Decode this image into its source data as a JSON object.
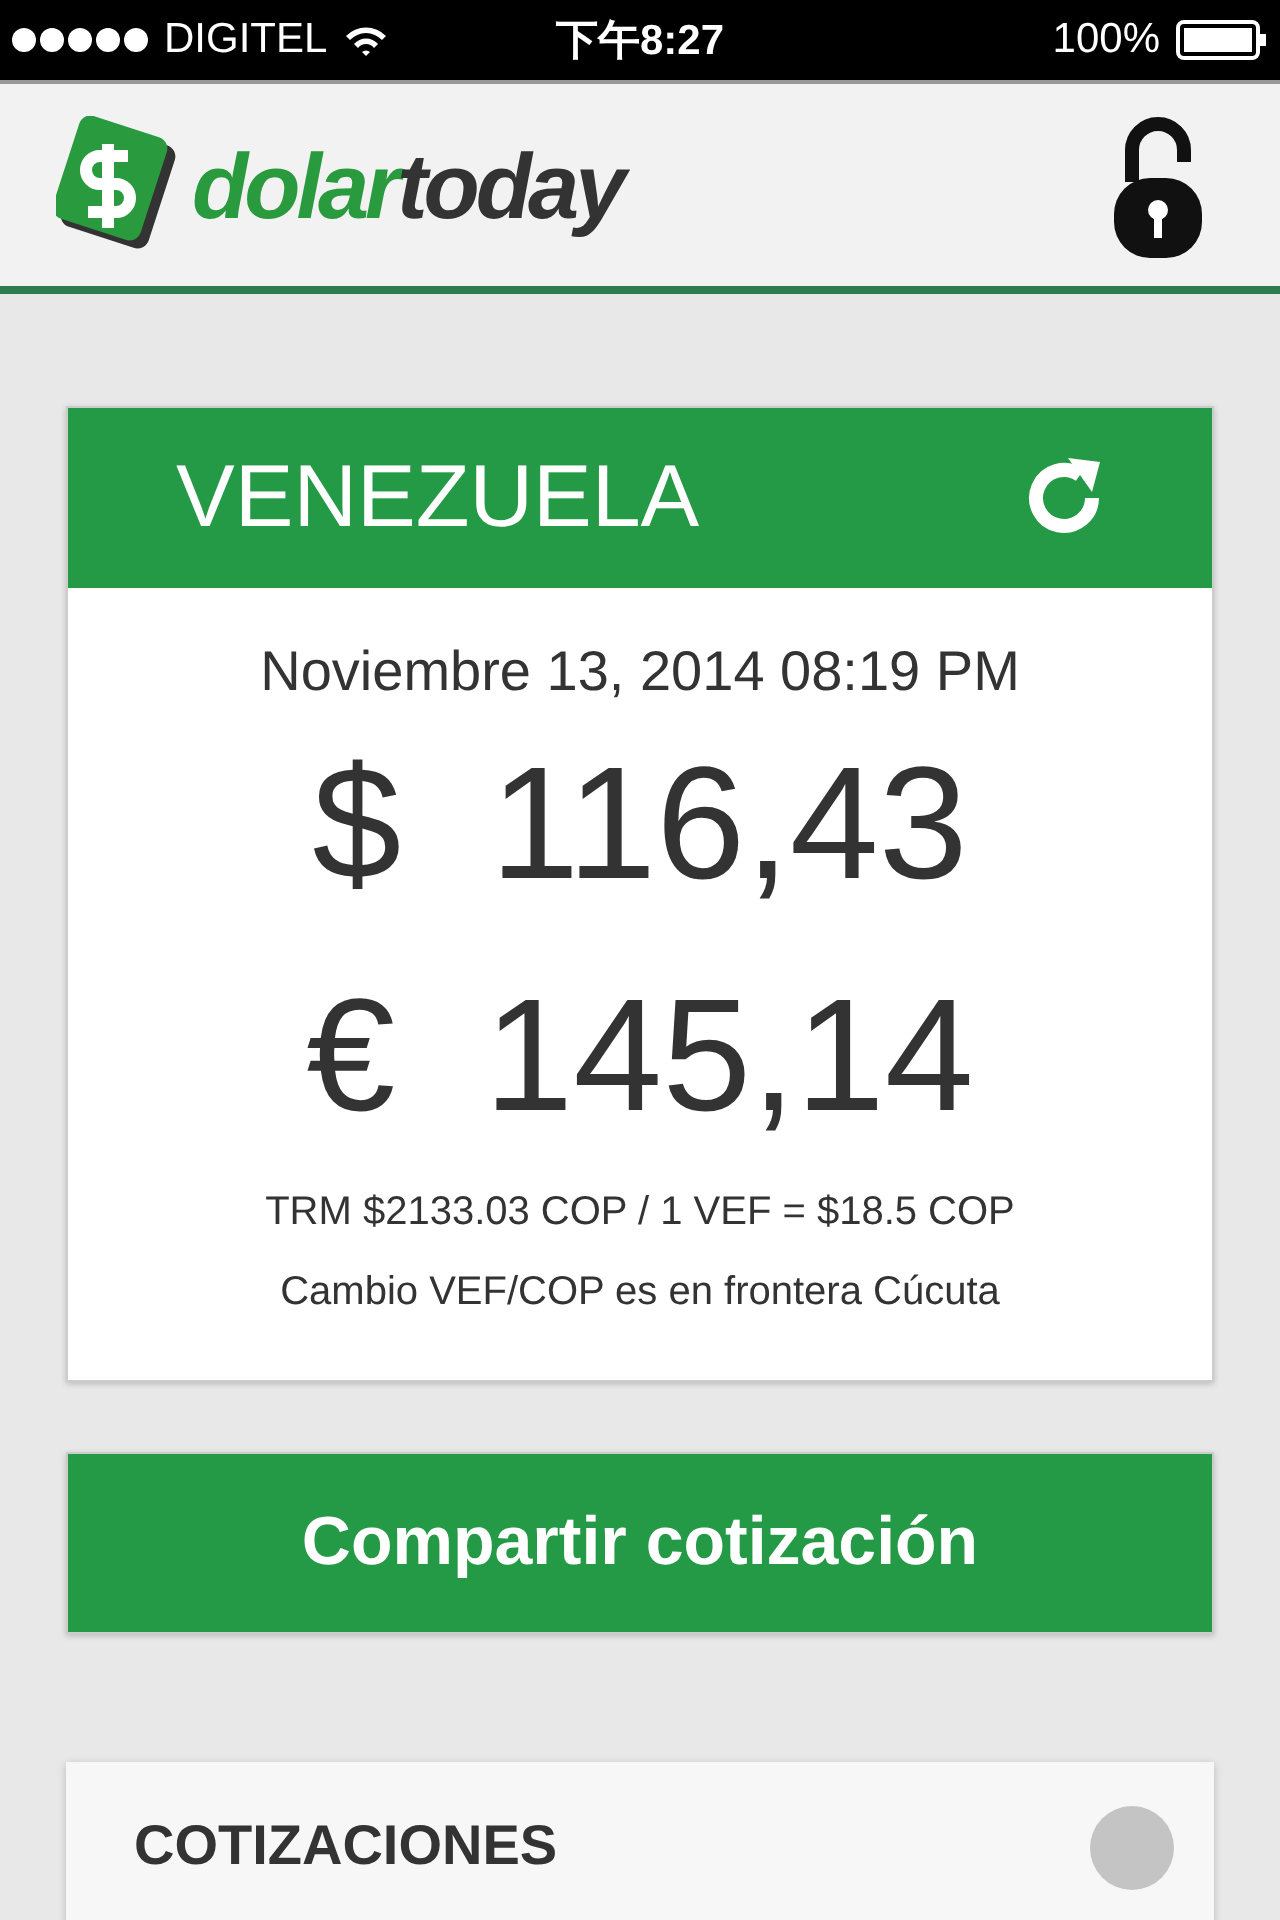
{
  "status_bar": {
    "carrier": "DIGITEL",
    "time": "下午8:27",
    "battery": "100%"
  },
  "header": {
    "logo": {
      "part_1": "dolar",
      "part_2": "today"
    },
    "locked": false
  },
  "rate_card": {
    "title": "VENEZUELA",
    "date": "Noviembre 13, 2014 08:19 PM",
    "prices": [
      {
        "symbol": "$",
        "value": "116,43"
      },
      {
        "symbol": "€",
        "value": "145,14"
      }
    ],
    "notes": [
      "TRM $2133.03 COP / 1 VEF = $18.5 COP",
      "Cambio VEF/COP es en frontera Cúcuta"
    ]
  },
  "share_button": "Compartir cotización",
  "quotes_card": {
    "title": "COTIZACIONES"
  }
}
